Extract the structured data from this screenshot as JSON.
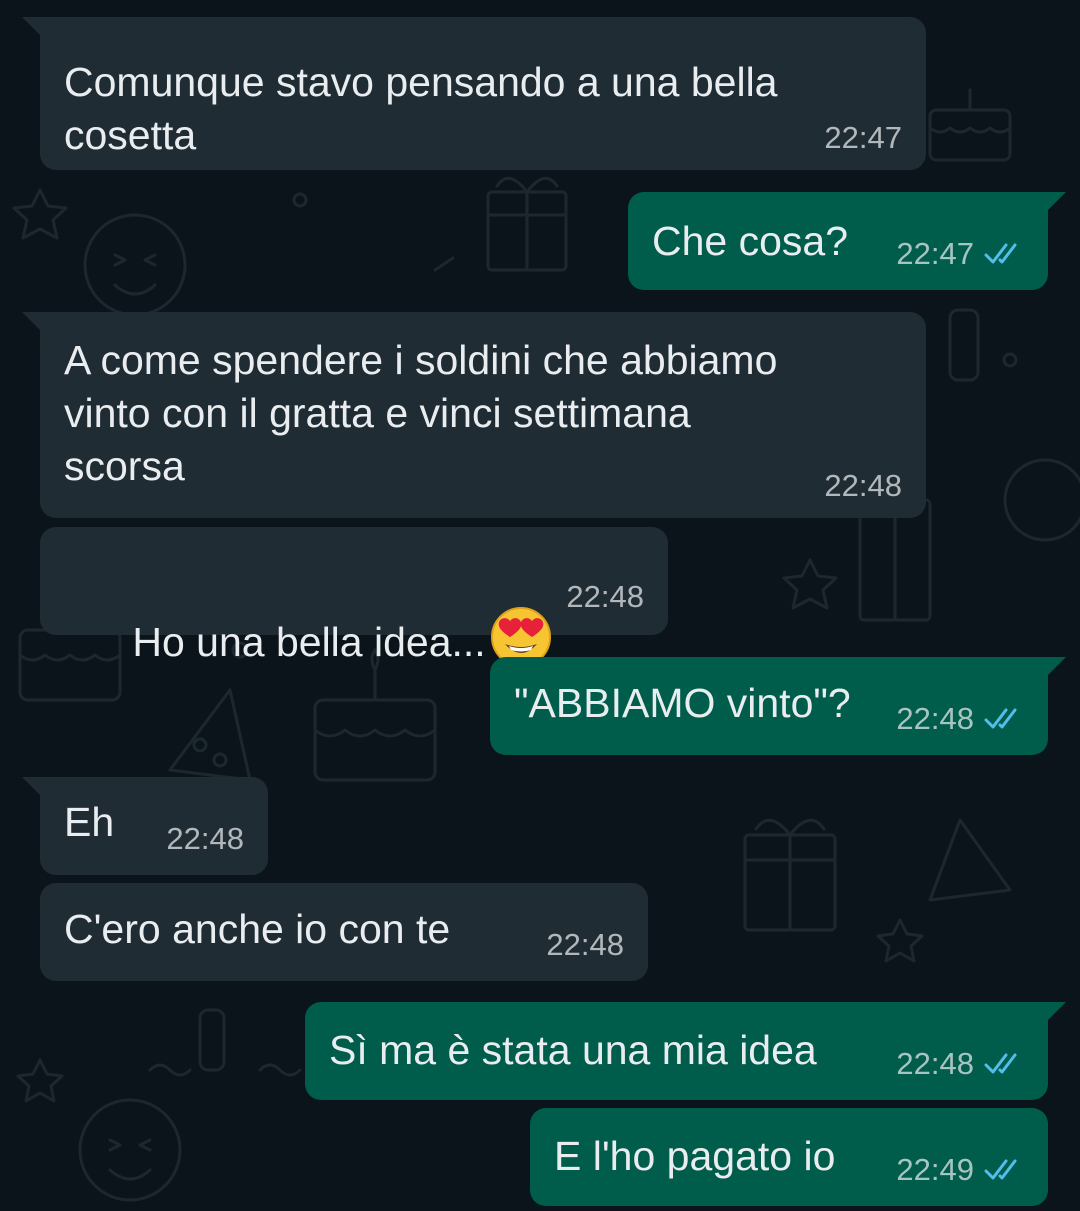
{
  "colors": {
    "background": "#0b141a",
    "incoming_bubble": "#202c33",
    "outgoing_bubble": "#005c4b",
    "text": "#e9edef",
    "read_ticks": "#53bdeb"
  },
  "messages": [
    {
      "direction": "in",
      "text": "Comunque stavo pensando a una bella\ncosetta",
      "time": "22:47"
    },
    {
      "direction": "out",
      "text": "Che cosa?",
      "time": "22:47",
      "status": "read"
    },
    {
      "direction": "in",
      "text": "A come spendere i soldini che abbiamo\nvinto con il gratta e vinci settimana\nscorsa",
      "time": "22:48"
    },
    {
      "direction": "in",
      "text": "Ho una bella idea...",
      "emoji": "smiling-face-with-heart-eyes",
      "time": "22:48"
    },
    {
      "direction": "out",
      "text": "\"ABBIAMO vinto\"?",
      "time": "22:48",
      "status": "read"
    },
    {
      "direction": "in",
      "text": "Eh",
      "time": "22:48"
    },
    {
      "direction": "in",
      "text": "C'ero anche io con te",
      "time": "22:48"
    },
    {
      "direction": "out",
      "text": "Sì ma è stata una mia idea",
      "time": "22:48",
      "status": "read"
    },
    {
      "direction": "out",
      "text": "E l'ho pagato io",
      "time": "22:49",
      "status": "read"
    }
  ]
}
